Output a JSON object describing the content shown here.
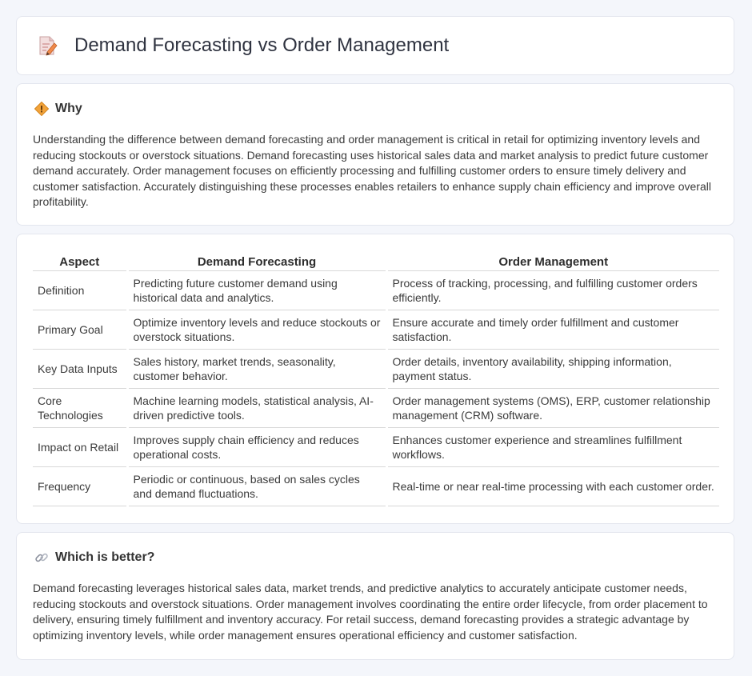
{
  "page": {
    "title": "Demand Forecasting vs Order Management"
  },
  "why": {
    "heading": "Why",
    "body": "Understanding the difference between demand forecasting and order management is critical in retail for optimizing inventory levels and reducing stockouts or overstock situations. Demand forecasting uses historical sales data and market analysis to predict future customer demand accurately. Order management focuses on efficiently processing and fulfilling customer orders to ensure timely delivery and customer satisfaction. Accurately distinguishing these processes enables retailers to enhance supply chain efficiency and improve overall profitability."
  },
  "table": {
    "headers": [
      "Aspect",
      "Demand Forecasting",
      "Order Management"
    ],
    "rows": [
      [
        "Definition",
        "Predicting future customer demand using historical data and analytics.",
        "Process of tracking, processing, and fulfilling customer orders efficiently."
      ],
      [
        "Primary Goal",
        "Optimize inventory levels and reduce stockouts or overstock situations.",
        "Ensure accurate and timely order fulfillment and customer satisfaction."
      ],
      [
        "Key Data Inputs",
        "Sales history, market trends, seasonality, customer behavior.",
        "Order details, inventory availability, shipping information, payment status."
      ],
      [
        "Core Technologies",
        "Machine learning models, statistical analysis, AI-driven predictive tools.",
        "Order management systems (OMS), ERP, customer relationship management (CRM) software."
      ],
      [
        "Impact on Retail",
        "Improves supply chain efficiency and reduces operational costs.",
        "Enhances customer experience and streamlines fulfillment workflows."
      ],
      [
        "Frequency",
        "Periodic or continuous, based on sales cycles and demand fluctuations.",
        "Real-time or near real-time processing with each customer order."
      ]
    ]
  },
  "better": {
    "heading": "Which is better?",
    "body": "Demand forecasting leverages historical sales data, market trends, and predictive analytics to accurately anticipate customer needs, reducing stockouts and overstock situations. Order management involves coordinating the entire order lifecycle, from order placement to delivery, ensuring timely fulfillment and inventory accuracy. For retail success, demand forecasting provides a strategic advantage by optimizing inventory levels, while order management ensures operational efficiency and customer satisfaction."
  },
  "icons": {
    "title": "document-pencil-icon",
    "why": "warning-diamond-icon",
    "better": "link-icon"
  }
}
